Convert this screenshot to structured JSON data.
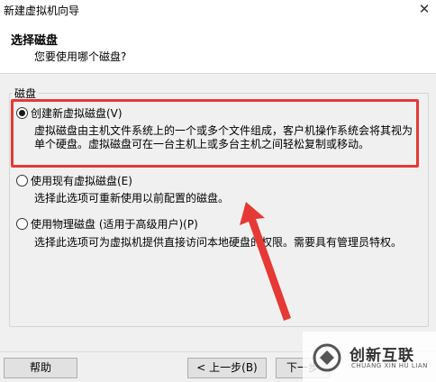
{
  "window": {
    "title": "新建虚拟机向导",
    "close_glyph": "✕"
  },
  "header": {
    "title": "选择磁盘",
    "subtitle": "您要使用哪个磁盘?"
  },
  "group": {
    "label": "磁盘"
  },
  "options": [
    {
      "label": "创建新虚拟磁盘(V)",
      "description": "虚拟磁盘由主机文件系统上的一个或多个文件组成，客户机操作系统会将其视为单个硬盘。虚拟磁盘可在一台主机上或多台主机之间轻松复制或移动。",
      "checked": true
    },
    {
      "label": "使用现有虚拟磁盘(E)",
      "description": "选择此选项可重新使用以前配置的磁盘。",
      "checked": false
    },
    {
      "label": "使用物理磁盘 (适用于高级用户)(P)",
      "description": "选择此选项可为虚拟机提供直接访问本地硬盘的权限。需要具有管理员特权。",
      "checked": false
    }
  ],
  "buttons": {
    "help": "帮助",
    "back": "< 上一步(B)",
    "next": "下一步"
  },
  "annotation": {
    "color": "#e53935"
  },
  "watermark": {
    "name_cn": "创新互联",
    "name_en": "CHUANG XIN HU LIAN",
    "icon": "chuangxin-logo-icon"
  }
}
